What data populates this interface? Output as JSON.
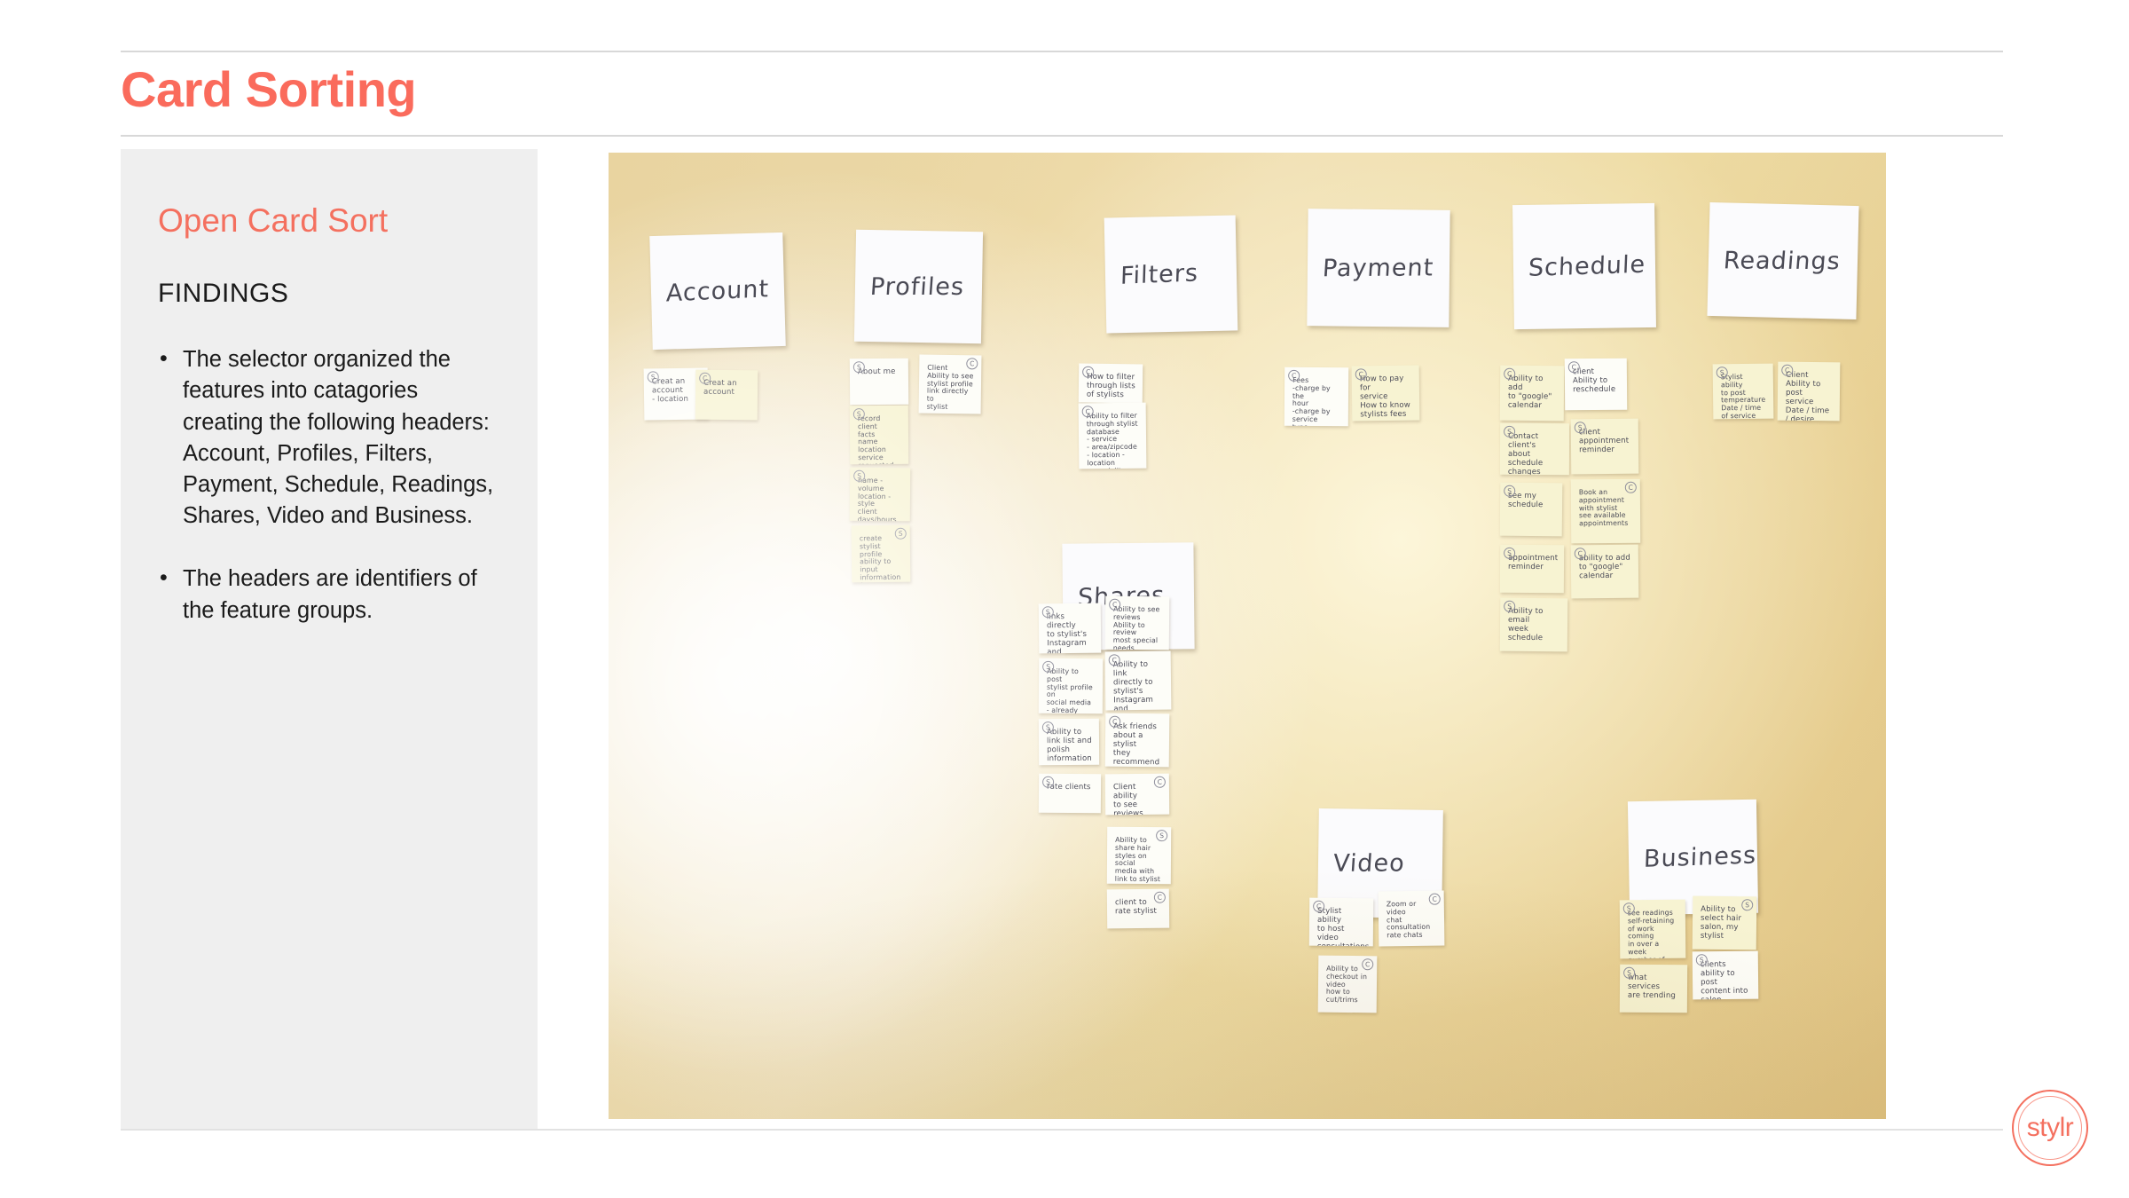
{
  "slide": {
    "title": "Card Sorting",
    "accent_color": "#fa6b5c",
    "sidebar_bg": "#efefef"
  },
  "sidebar": {
    "title": "Open Card Sort",
    "subtitle": "FINDINGS",
    "findings": [
      "The selector organized the features into catagories creating the following headers: Account, Profiles, Filters, Payment, Schedule, Readings, Shares, Video and Business.",
      "The headers are identifiers of the feature groups."
    ]
  },
  "photo": {
    "description": "Photograph of a wall with handwritten card-sort header cards and sticky notes",
    "header_cards": [
      {
        "label": "Account"
      },
      {
        "label": "Profiles"
      },
      {
        "label": "Filters"
      },
      {
        "label": "Payment"
      },
      {
        "label": "Schedule"
      },
      {
        "label": "Readings"
      },
      {
        "label": "Shares"
      },
      {
        "label": "Video"
      },
      {
        "label": "Business"
      }
    ],
    "sticky_notes": [
      {
        "group": "Account",
        "mark": "S",
        "mark_side": "l",
        "text": "Creat an\naccount\n- location"
      },
      {
        "group": "Account",
        "mark": "C",
        "mark_side": "l",
        "text": "Creat an\naccount"
      },
      {
        "group": "Profiles",
        "mark": "S",
        "mark_side": "l",
        "text": "About me"
      },
      {
        "group": "Profiles",
        "mark": "C",
        "mark_side": "r",
        "text": "Client\nAbility to see\nstylist profile\nlink directly to\nstylist"
      },
      {
        "group": "Profiles",
        "mark": "S",
        "mark_side": "l",
        "text": "record client\nfacts\nname\nlocation\nservice requested\nHistory\nformulas and\npreferences"
      },
      {
        "group": "Profiles",
        "mark": "S",
        "mark_side": "l",
        "text": "name   - volume\nlocation - style\n            client\ndays/hours availability\nservice\nspecialize"
      },
      {
        "group": "Profiles",
        "mark": "S",
        "mark_side": "r",
        "text": "create stylist\nprofile\nability to input\ninformation\nfees\nconsultation policy\npayment"
      },
      {
        "group": "Filters",
        "mark": "C",
        "mark_side": "l",
        "text": "How to filter\nthrough lists\nof stylists"
      },
      {
        "group": "Filters",
        "mark": "C",
        "mark_side": "l",
        "text": "Ability to filter\nthrough stylist\ndatabase\n- service\n- area/zipcode\n- location - location\n- speciality\n- male/female"
      },
      {
        "group": "Payment",
        "mark": "C",
        "mark_side": "l",
        "text": "Fees\n-charge by the\nhour\n-charge by service\ntype\n-charge by length\nof hair"
      },
      {
        "group": "Payment",
        "mark": "C",
        "mark_side": "l",
        "text": "How to pay for\nservice\nHow to know\nstylists fees"
      },
      {
        "group": "Schedule",
        "mark": "C",
        "mark_side": "l",
        "text": "Ability to add\nto \"google\"\ncalendar"
      },
      {
        "group": "Schedule",
        "mark": "C",
        "mark_side": "l",
        "text": "client\nAbility to\nreschedule"
      },
      {
        "group": "Schedule",
        "mark": "S",
        "mark_side": "l",
        "text": "Contact client's\nabout schedule\nchanges"
      },
      {
        "group": "Schedule",
        "mark": "S",
        "mark_side": "l",
        "text": "client\nappointment\nreminder"
      },
      {
        "group": "Schedule",
        "mark": "S",
        "mark_side": "l",
        "text": "see my\nschedule"
      },
      {
        "group": "Schedule",
        "mark": "C",
        "mark_side": "r",
        "text": "Book an\nappointment\nwith stylist\nsee available\nappointments"
      },
      {
        "group": "Schedule",
        "mark": "S",
        "mark_side": "l",
        "text": "appointment\nreminder"
      },
      {
        "group": "Schedule",
        "mark": "C",
        "mark_side": "l",
        "text": "ability to add\nto \"google\"\ncalendar"
      },
      {
        "group": "Schedule",
        "mark": "S",
        "mark_side": "l",
        "text": "Ability to\nemail\nweek schedule"
      },
      {
        "group": "Readings",
        "mark": "S",
        "mark_side": "l",
        "text": "Stylist ability\nto post\ntemperature\nDate / time\nof service"
      },
      {
        "group": "Readings",
        "mark": "C",
        "mark_side": "l",
        "text": "Client\nAbility to\npost service\nDate / time / desire"
      },
      {
        "group": "Shares",
        "mark": "S",
        "mark_side": "l",
        "text": "links directly\nto stylist's\nInstagram and\nFacebook pages"
      },
      {
        "group": "Shares",
        "mark": "C",
        "mark_side": "l",
        "text": "Ability to see\nreviews\nAbility to review\nmost special\nneeds"
      },
      {
        "group": "Shares",
        "mark": "S",
        "mark_side": "l",
        "text": "Ability to post\nstylist profile on\nsocial media\n- already have\nfollowers"
      },
      {
        "group": "Shares",
        "mark": "C",
        "mark_side": "l",
        "text": "Ability to link\ndirectly to\nstylist's Instagram\nand Facebook page"
      },
      {
        "group": "Shares",
        "mark": "S",
        "mark_side": "l",
        "text": "Ability to\nlink list and\npolish\ninformation"
      },
      {
        "group": "Shares",
        "mark": "C",
        "mark_side": "l",
        "text": "Ask friends\nabout a stylist\nthey recommend"
      },
      {
        "group": "Shares",
        "mark": "S",
        "mark_side": "l",
        "text": "rate clients"
      },
      {
        "group": "Shares",
        "mark": "C",
        "mark_side": "r",
        "text": "Client ability\nto see reviews"
      },
      {
        "group": "Shares",
        "mark": "S",
        "mark_side": "r",
        "text": "Ability to\nshare hair\nstyles on social\nmedia with\nlink to stylist"
      },
      {
        "group": "Shares",
        "mark": "C",
        "mark_side": "r",
        "text": "client to\nrate stylist"
      },
      {
        "group": "Video",
        "mark": "C",
        "mark_side": "l",
        "text": "Stylist ability\nto host video\nconsultations"
      },
      {
        "group": "Video",
        "mark": "C",
        "mark_side": "r",
        "text": "Zoom or\nvideo\nchat\nconsultation\nrate chats"
      },
      {
        "group": "Video",
        "mark": "C",
        "mark_side": "r",
        "text": "Ability to\ncheckout in\nvideo\nhow to\ncut/trims"
      },
      {
        "group": "Business",
        "mark": "S",
        "mark_side": "l",
        "text": "see readings\nself-retaining\nof work coming\nin over a week\nnumber of clients"
      },
      {
        "group": "Business",
        "mark": "S",
        "mark_side": "r",
        "text": "Ability to\nselect hair\nsalon, my\nstylist"
      },
      {
        "group": "Business",
        "mark": "S",
        "mark_side": "l",
        "text": "clients\nability to post\ncontent into salon"
      },
      {
        "group": "Business",
        "mark": "S",
        "mark_side": "l",
        "text": "what services\nare trending"
      }
    ]
  },
  "logo": {
    "text": "stylr"
  }
}
